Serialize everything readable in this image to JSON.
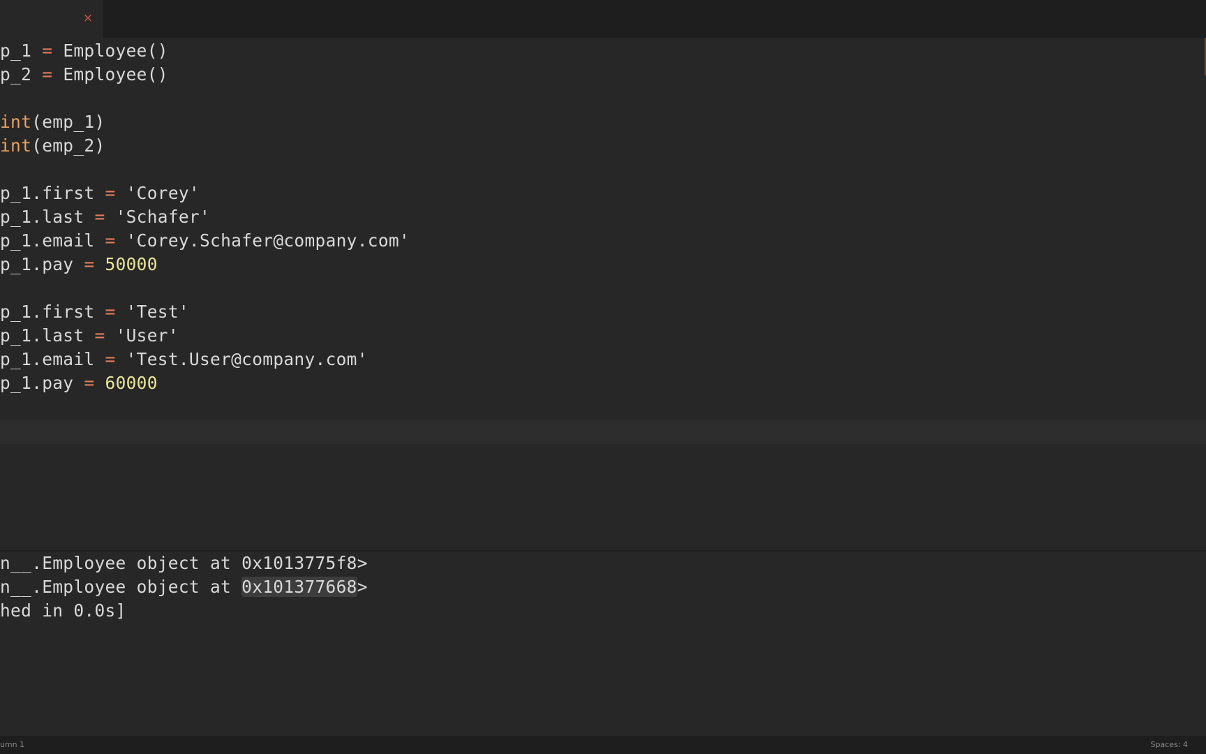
{
  "tab": {
    "close_glyph": "×"
  },
  "editor": {
    "lines": [
      {
        "id": "l1",
        "parts": [
          [
            "txt",
            "p_1 "
          ],
          [
            "op",
            "="
          ],
          [
            "txt",
            " Employee()"
          ]
        ]
      },
      {
        "id": "l2",
        "parts": [
          [
            "txt",
            "p_2 "
          ],
          [
            "op",
            "="
          ],
          [
            "txt",
            " Employee()"
          ]
        ]
      },
      {
        "id": "l3",
        "parts": []
      },
      {
        "id": "l4",
        "parts": [
          [
            "kw",
            "int"
          ],
          [
            "txt",
            "(emp_1)"
          ]
        ]
      },
      {
        "id": "l5",
        "parts": [
          [
            "kw",
            "int"
          ],
          [
            "txt",
            "(emp_2)"
          ]
        ]
      },
      {
        "id": "l6",
        "parts": []
      },
      {
        "id": "l7",
        "parts": [
          [
            "txt",
            "p_1.first "
          ],
          [
            "op",
            "="
          ],
          [
            "str",
            " 'Corey'"
          ]
        ]
      },
      {
        "id": "l8",
        "parts": [
          [
            "txt",
            "p_1.last "
          ],
          [
            "op",
            "="
          ],
          [
            "str",
            " 'Schafer'"
          ]
        ]
      },
      {
        "id": "l9",
        "parts": [
          [
            "txt",
            "p_1.email "
          ],
          [
            "op",
            "="
          ],
          [
            "str",
            " 'Corey.Schafer@company.com'"
          ]
        ]
      },
      {
        "id": "l10",
        "parts": [
          [
            "txt",
            "p_1.pay "
          ],
          [
            "op",
            "="
          ],
          [
            "num",
            " 50000"
          ]
        ]
      },
      {
        "id": "l11",
        "parts": []
      },
      {
        "id": "l12",
        "parts": [
          [
            "txt",
            "p_1.first "
          ],
          [
            "op",
            "="
          ],
          [
            "str",
            " 'Test'"
          ]
        ]
      },
      {
        "id": "l13",
        "parts": [
          [
            "txt",
            "p_1.last "
          ],
          [
            "op",
            "="
          ],
          [
            "str",
            " 'User'"
          ]
        ]
      },
      {
        "id": "l14",
        "parts": [
          [
            "txt",
            "p_1.email "
          ],
          [
            "op",
            "="
          ],
          [
            "str",
            " 'Test.User@company.com'"
          ]
        ]
      },
      {
        "id": "l15",
        "parts": [
          [
            "txt",
            "p_1.pay "
          ],
          [
            "op",
            "="
          ],
          [
            "num",
            " 60000"
          ]
        ]
      }
    ]
  },
  "output": {
    "line1": "n__.Employee object at 0x1013775f8>",
    "line2_prefix": "n__.Employee object at ",
    "line2_selected": "0x101377668",
    "line2_suffix": ">",
    "line3": "hed in 0.0s]"
  },
  "status": {
    "left": "umn 1",
    "right": "Spaces: 4"
  }
}
